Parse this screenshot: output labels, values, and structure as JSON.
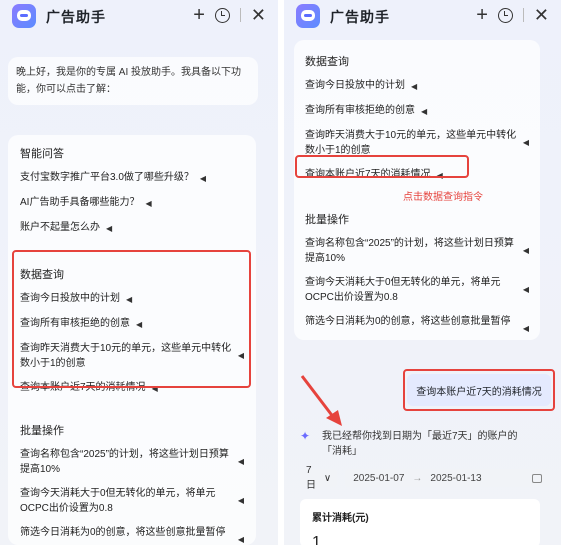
{
  "app": {
    "title": "广告助手"
  },
  "greeting": "晚上好，我是你的专属 AI 投放助手。我具备以下功能，你可以点击了解：",
  "sections": {
    "qa": {
      "title": "智能问答",
      "items": [
        "支付宝数字推广平台3.0做了哪些升级？",
        "AI广告助手具备哪些能力？",
        "账户不起量怎么办"
      ]
    },
    "query": {
      "title": "数据查询",
      "items": [
        "查询今日投放中的计划",
        "查询所有审核拒绝的创意",
        "查询昨天消费大于10元的单元，这些单元中转化数小于1的创意",
        "查询本账户近7天的消耗情况"
      ]
    },
    "batch": {
      "title": "批量操作",
      "items": [
        "查询名称包含“2025”的计划，将这些计划日预算提高10%",
        "查询今天消耗大于0但无转化的单元，将单元OCPC出价设置为0.8",
        "筛选今日消耗为0的创意，将这些创意批量暂停"
      ]
    }
  },
  "annotation": "点击数据查询指令",
  "user_message": "查询本账户近7天的消耗情况",
  "reply": {
    "message": "我已经帮你找到日期为「最近7天」的账户的「消耗」",
    "period": "7日",
    "date_start": "2025-01-07",
    "date_end": "2025-01-13",
    "stat_label": "累计消耗(元)",
    "stat_value": "1"
  },
  "colors": {
    "highlight": "#e6433d",
    "bubble": "#e4eafe",
    "accent": "#6b6bff"
  },
  "icons": {
    "add": "plus-icon",
    "history": "history-icon",
    "close": "close-icon",
    "send": "send-icon",
    "calendar": "calendar-icon",
    "sparkle": "sparkle-icon"
  }
}
